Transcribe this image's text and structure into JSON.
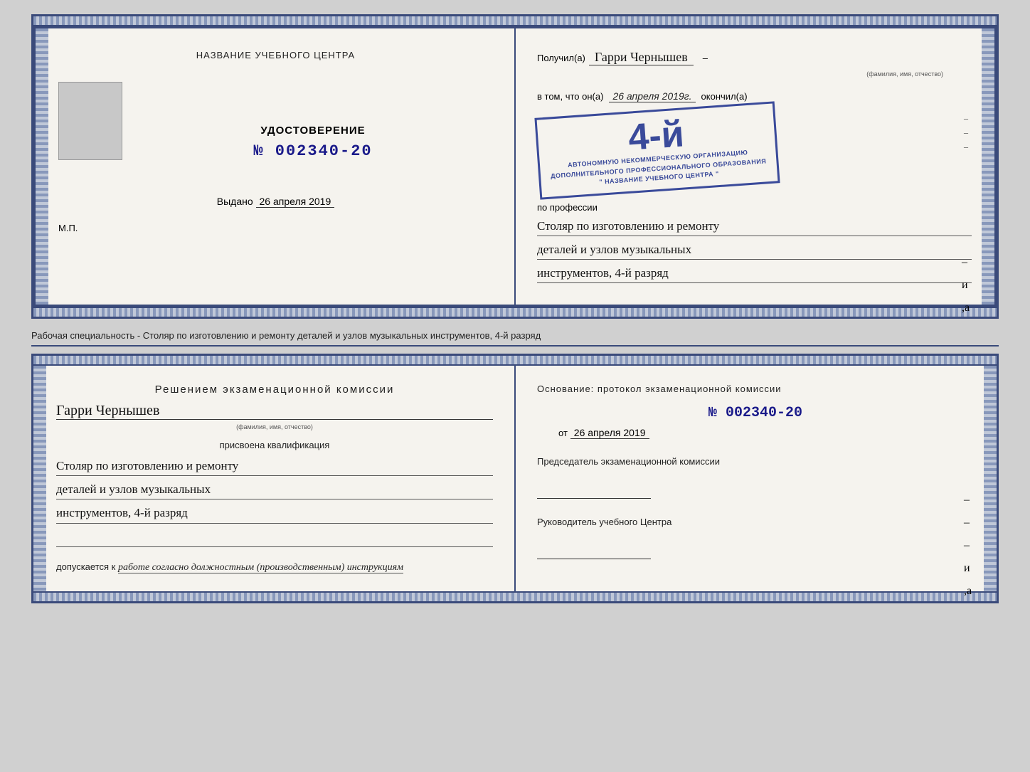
{
  "top_booklet": {
    "left": {
      "center_title": "НАЗВАНИЕ УЧЕБНОГО ЦЕНТРА",
      "udostoverenie": "УДОСТОВЕРЕНИЕ",
      "number": "№ 002340-20",
      "vydano_label": "Выдано",
      "vydano_date": "26 апреля 2019",
      "mp": "М.П."
    },
    "right": {
      "poluchil_prefix": "Получил(а)",
      "fio": "Гарри Чернышев",
      "fio_label": "(фамилия, имя, отчество)",
      "v_tom_chto": "в том, что он(а)",
      "date": "26 апреля 2019г.",
      "okonchil": "окончил(а)",
      "stamp_4": "4-й",
      "stamp_line1": "АВТОНОМНУЮ НЕКОММЕРЧЕСКУЮ ОРГАНИЗАЦИЮ",
      "stamp_line2": "ДОПОЛНИТЕЛЬНОГО ПРОФЕССИОНАЛЬНОГО ОБРАЗОВАНИЯ",
      "stamp_line3": "\" НАЗВАНИЕ УЧЕБНОГО ЦЕНТРА \"",
      "po_professii": "по профессии",
      "profession_line1": "Столяр по изготовлению и ремонту",
      "profession_line2": "деталей и узлов музыкальных",
      "profession_line3": "инструментов, 4-й разряд"
    }
  },
  "separator": {
    "text": "Рабочая специальность - Столяр по изготовлению и ремонту деталей и узлов музыкальных инструментов, 4-й разряд"
  },
  "bottom_booklet": {
    "left": {
      "resheniem_title": "Решением  экзаменационной  комиссии",
      "fio": "Гарри Чернышев",
      "fio_label": "(фамилия, имя, отчество)",
      "prisvoena": "присвоена квалификация",
      "profession_line1": "Столяр по изготовлению и ремонту",
      "profession_line2": "деталей и узлов музыкальных",
      "profession_line3": "инструментов, 4-й разряд",
      "dopuskaetsya_prefix": "допускается к",
      "dopuskaetsya_text": "работе согласно должностным (производственным) инструкциям"
    },
    "right": {
      "osnovanie_title": "Основание:  протокол  экзаменационной  комиссии",
      "number": "№  002340-20",
      "ot_prefix": "от",
      "ot_date": "26 апреля 2019",
      "predsedatel_label": "Председатель экзаменационной комиссии",
      "rukovoditel_label": "Руководитель учебного Центра"
    }
  }
}
